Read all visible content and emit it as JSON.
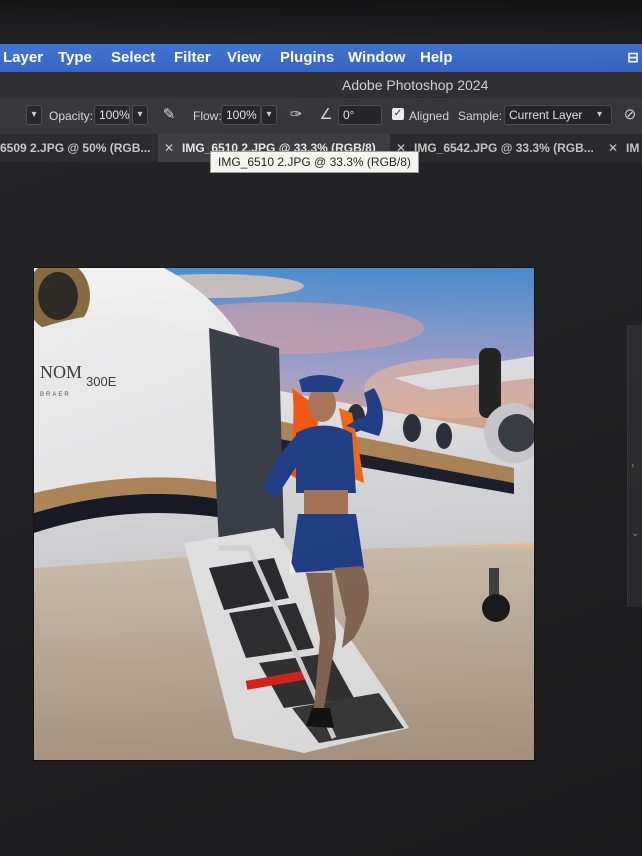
{
  "app": {
    "title": "Adobe Photoshop 2024"
  },
  "menubar": {
    "items": [
      "Layer",
      "Type",
      "Select",
      "Filter",
      "View",
      "Plugins",
      "Window",
      "Help"
    ],
    "control_icon": "control-center-icon"
  },
  "options": {
    "opacity_label": "Opacity:",
    "opacity_value": "100%",
    "flow_label": "Flow:",
    "flow_value": "100%",
    "angle_value": "0°",
    "aligned_label": "Aligned",
    "aligned_checked": true,
    "sample_label": "Sample:",
    "sample_value": "Current Layer",
    "icons": [
      "pressure-opacity-icon",
      "airbrush-icon",
      "angle-icon",
      "ignore-adjustment-layers-icon"
    ]
  },
  "tabs": [
    {
      "label": "6509 2.JPG @ 50% (RGB...",
      "active": false
    },
    {
      "label": "IMG_6510 2.JPG @ 33.3% (RGB/8)",
      "active": true
    },
    {
      "label": "IMG_6542.JPG @ 33.3% (RGB...",
      "active": false
    },
    {
      "label": "IM",
      "active": false
    }
  ],
  "tooltip": "IMG_6510 2.JPG @ 33.3% (RGB/8)",
  "document_image": {
    "subject": "woman in blue flight attendant uniform on private jet stairs",
    "jet_text": "NOM",
    "jet_model": "300E",
    "jet_subtext": "BRAER"
  },
  "colors": {
    "menubar": "#3463c6",
    "uniform": "#1f3f8c",
    "hair": "#ff5a10",
    "sky_top": "#4b8fd6",
    "sky_glow": "#f6b37a"
  }
}
